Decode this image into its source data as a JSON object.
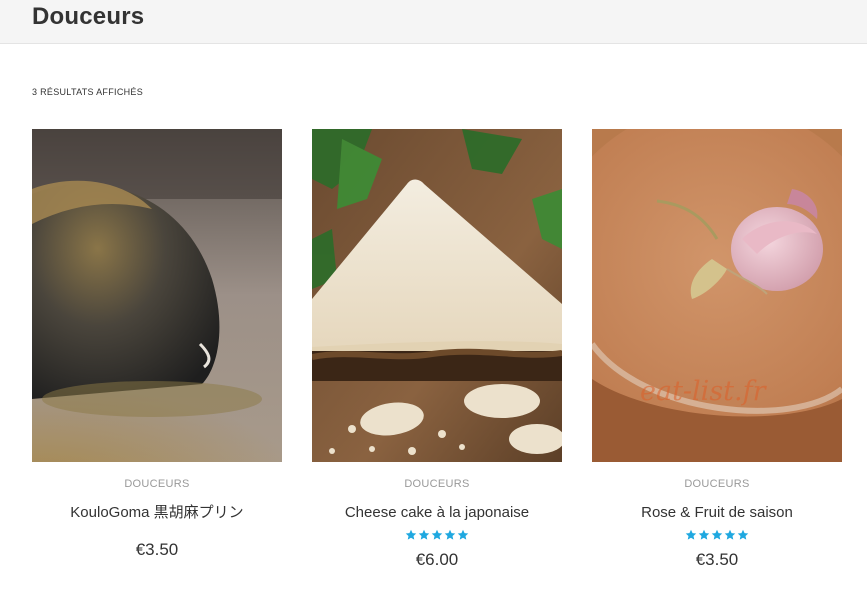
{
  "page": {
    "title": "Douceurs"
  },
  "shop": {
    "result_count": "3 RÉSULTATS AFFICHÉS"
  },
  "colors": {
    "star": "#1fa8e0",
    "category": "#999999",
    "text": "#333333"
  },
  "products": [
    {
      "category": "DOUCEURS",
      "name": "KouloGoma 黒胡麻プリン",
      "price": "€3.50",
      "rating": 0,
      "image": "black-sesame-pudding-photo"
    },
    {
      "category": "DOUCEURS",
      "name": "Cheese cake à la japonaise",
      "price": "€6.00",
      "rating": 5,
      "image": "cheesecake-photo"
    },
    {
      "category": "DOUCEURS",
      "name": "Rose & Fruit de saison",
      "price": "€3.50",
      "rating": 5,
      "image": "rose-jelly-photo",
      "watermark": "eat-list.fr"
    }
  ]
}
